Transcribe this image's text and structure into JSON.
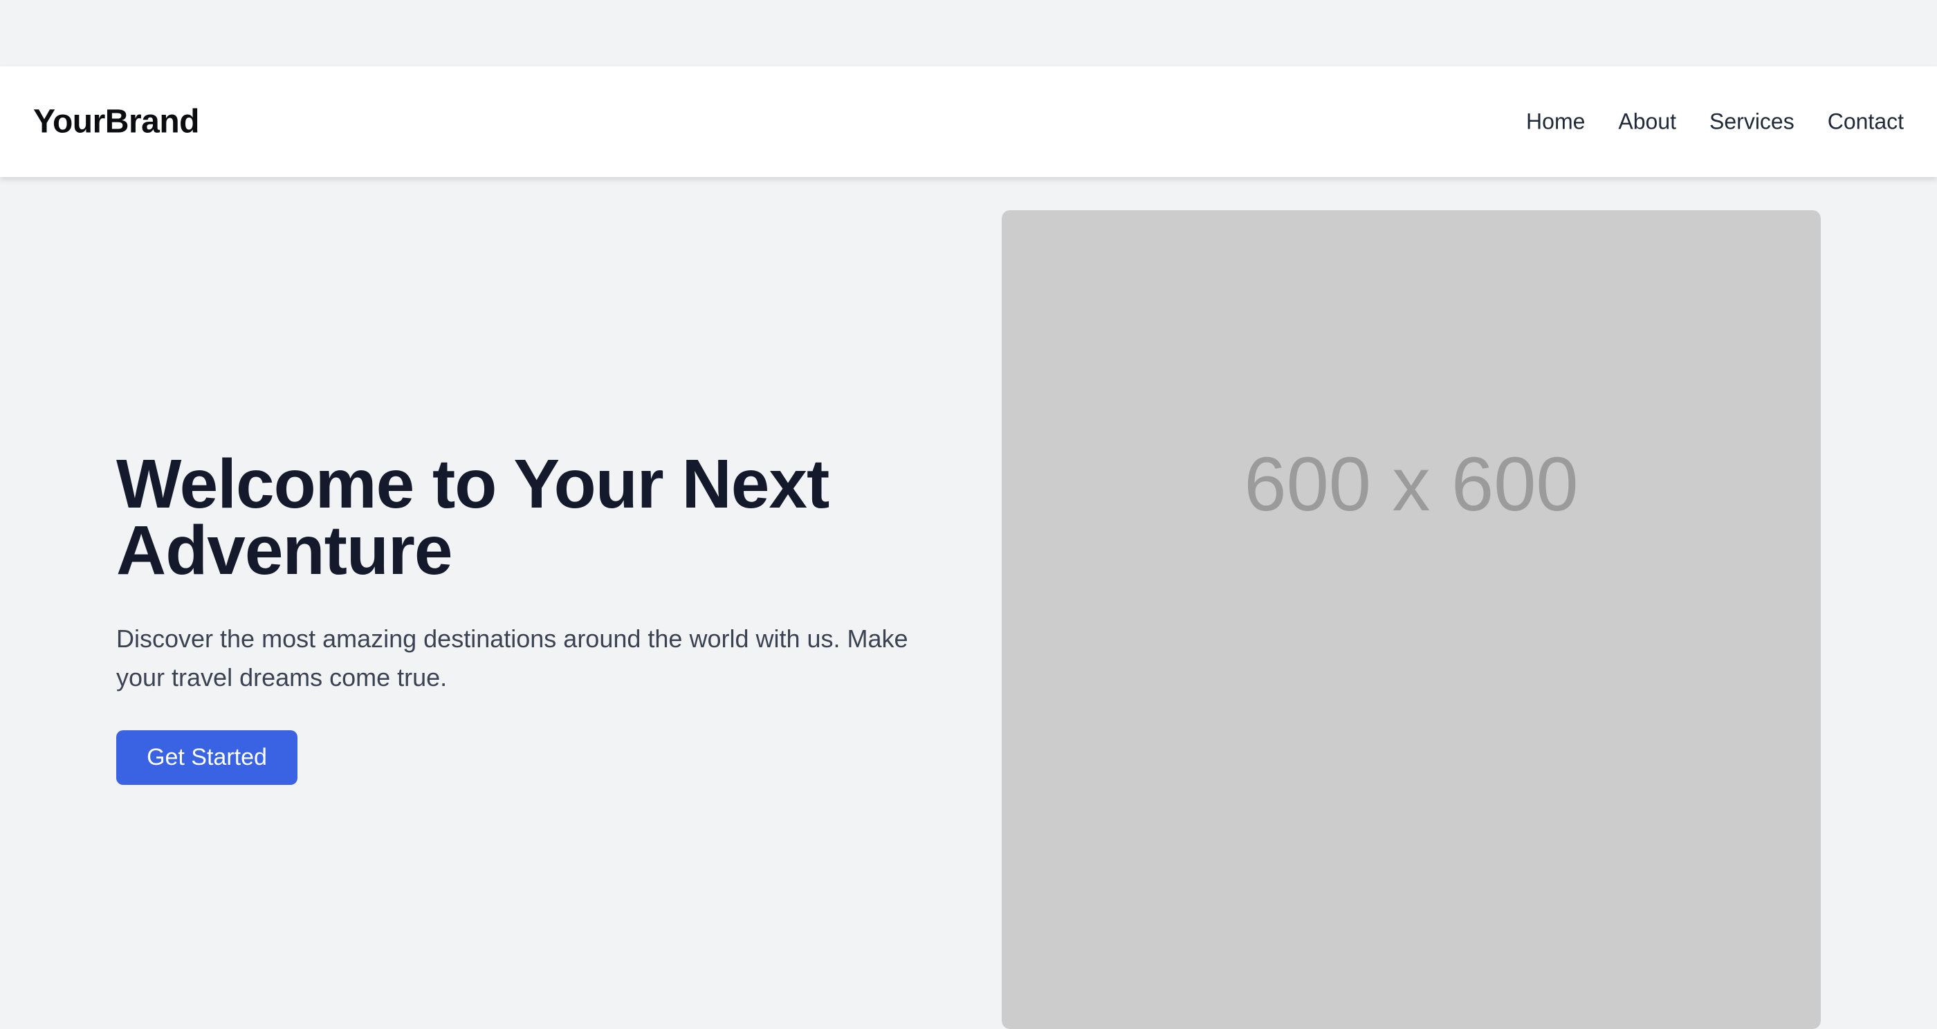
{
  "navbar": {
    "brand": "YourBrand",
    "links": [
      {
        "label": "Home"
      },
      {
        "label": "About"
      },
      {
        "label": "Services"
      },
      {
        "label": "Contact"
      }
    ]
  },
  "hero": {
    "title": "Welcome to Your Next Adventure",
    "subtitle": "Discover the most amazing destinations around the world with us. Make your travel dreams come true.",
    "cta_label": "Get Started",
    "image_placeholder_text": "600 x 600"
  },
  "colors": {
    "page_background": "#f2f3f5",
    "navbar_background": "#ffffff",
    "accent": "#3a63e3",
    "placeholder_background": "#cccccc"
  }
}
